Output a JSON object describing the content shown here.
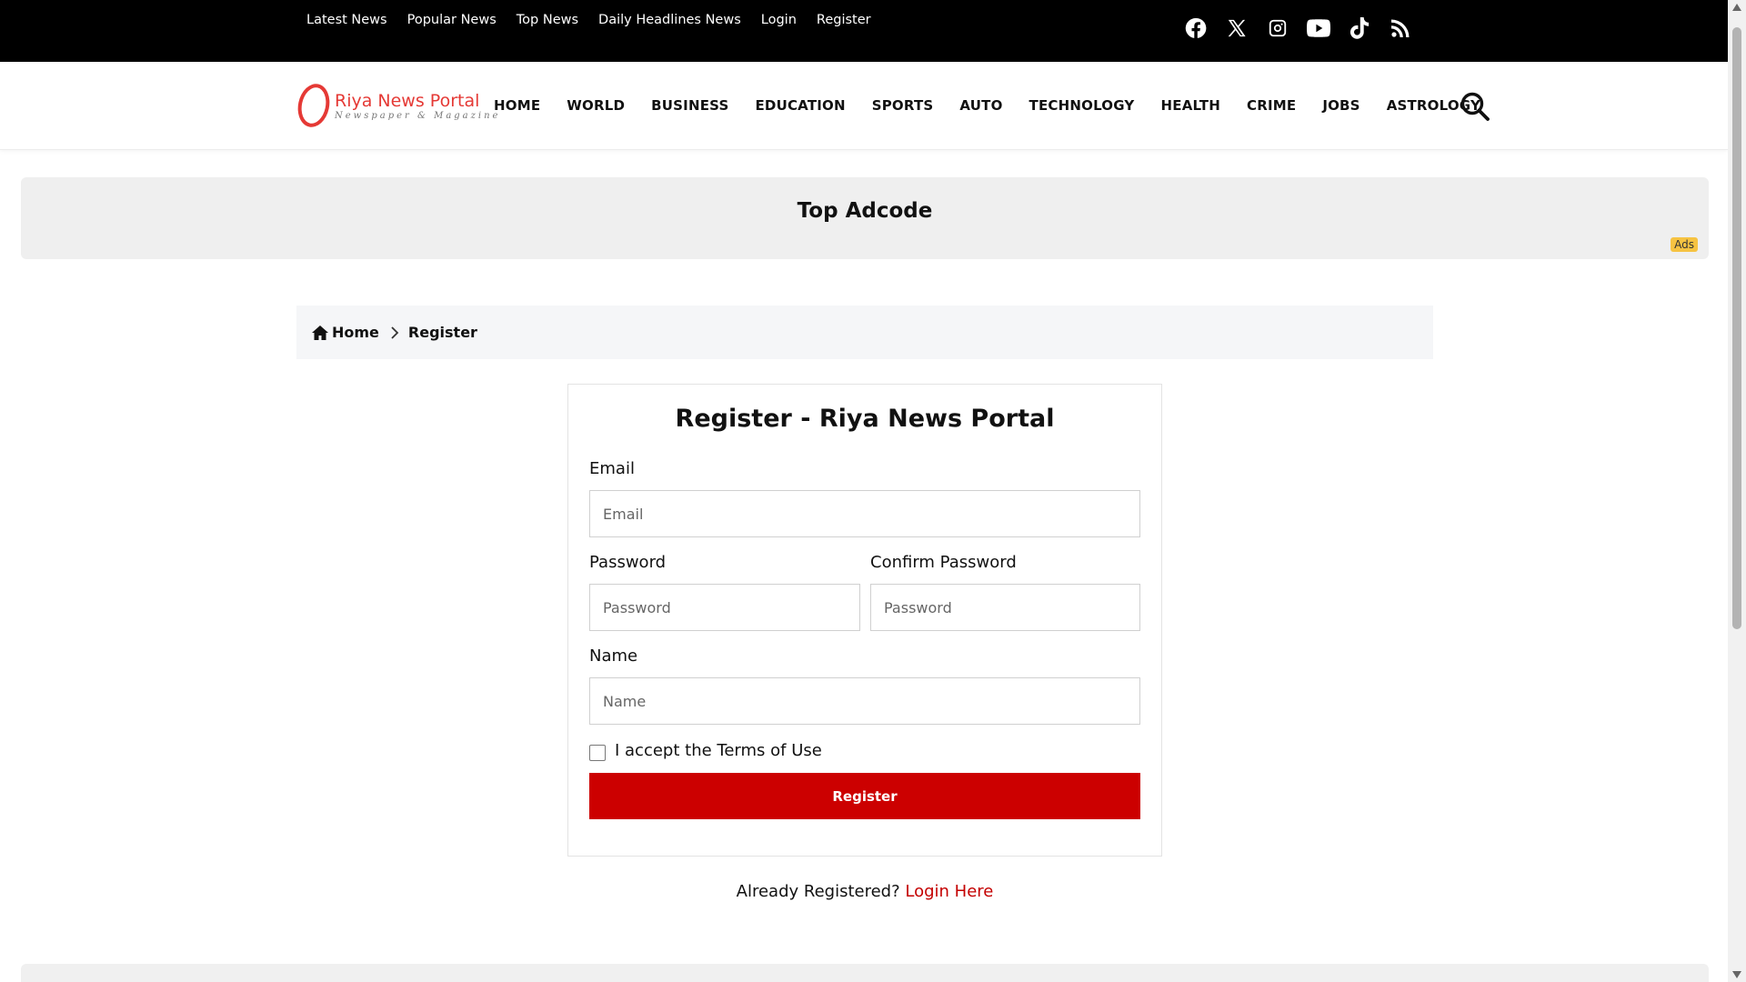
{
  "topbar": {
    "links": [
      "Latest News",
      "Popular News",
      "Top News",
      "Daily Headlines News",
      "Login",
      "Register"
    ],
    "socials": [
      "facebook-icon",
      "x-icon",
      "instagram-icon",
      "youtube-icon",
      "tiktok-icon",
      "rss-icon"
    ]
  },
  "header": {
    "logo_title": "Riya News Portal",
    "logo_subtitle": "Newspaper & Magazine",
    "nav": [
      "HOME",
      "WORLD",
      "BUSINESS",
      "EDUCATION",
      "SPORTS",
      "AUTO",
      "TECHNOLOGY",
      "HEALTH",
      "CRIME",
      "JOBS",
      "ASTROLOGY"
    ]
  },
  "ad": {
    "title": "Top Adcode",
    "tag": "Ads"
  },
  "breadcrumb": {
    "home": "Home",
    "current": "Register"
  },
  "form": {
    "title": "Register - Riya News Portal",
    "email_label": "Email",
    "email_placeholder": "Email",
    "password_label": "Password",
    "password_placeholder": "Password",
    "confirm_label": "Confirm Password",
    "confirm_placeholder": "Password",
    "name_label": "Name",
    "name_placeholder": "Name",
    "terms_label": "I accept the Terms of Use",
    "terms_checked": false,
    "submit_label": "Register"
  },
  "login_prompt": {
    "text": "Already Registered?",
    "link": "Login Here"
  },
  "colors": {
    "accent": "#cc0000",
    "logo": "#e53935",
    "topbar": "#000000",
    "ad_tag": "#f6c342"
  }
}
